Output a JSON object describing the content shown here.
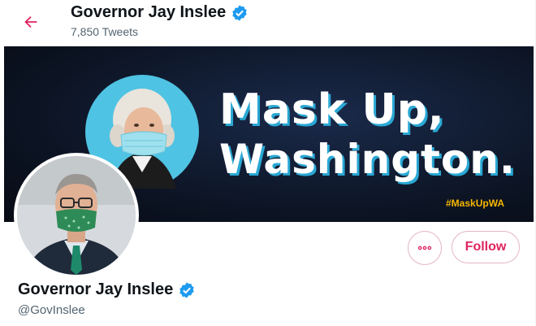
{
  "header": {
    "title": "Governor Jay Inslee",
    "tweet_count": "7,850 Tweets",
    "back_icon": "arrow-left-icon"
  },
  "banner": {
    "headline_line1": "Mask Up,",
    "headline_line2": "Washington.",
    "hashtag": "#MaskUpWA"
  },
  "profile": {
    "name": "Governor Jay Inslee",
    "handle": "@GovInslee",
    "verified": true
  },
  "actions": {
    "more_icon": "more-options-icon",
    "follow_label": "Follow"
  },
  "colors": {
    "accent": "#e0245e",
    "verified": "#1d9bf0",
    "banner_bg": "#0b1220",
    "banner_circle": "#4fc3e3",
    "hashtag": "#f5b700"
  }
}
